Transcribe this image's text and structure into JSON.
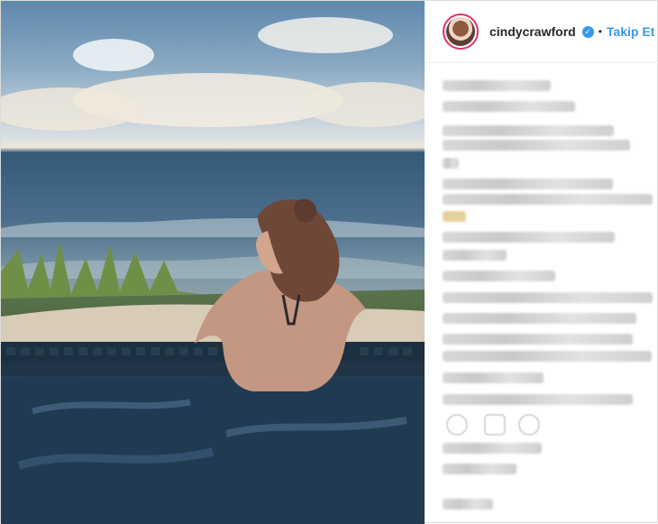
{
  "post": {
    "username": "cindycrawford",
    "follow_label": "Takip Et",
    "dot": "•",
    "verified_symbol": "✓",
    "icons": [
      "heart-icon",
      "comment-icon",
      "share-icon"
    ]
  }
}
